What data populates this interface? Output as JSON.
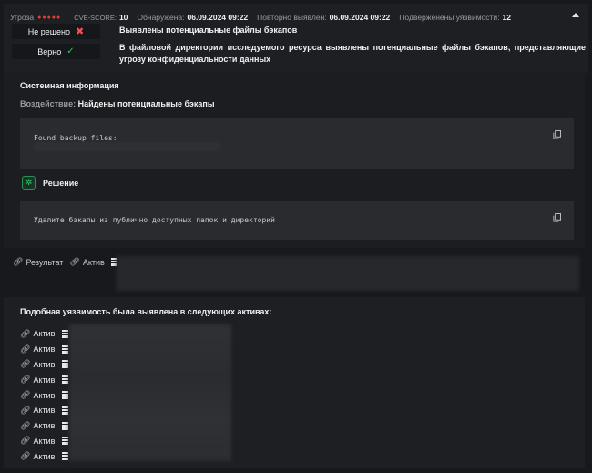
{
  "header": {
    "threat_label": "Угроза",
    "threat_dots": "●●●●●",
    "cve_label": "CVE-SCORE:",
    "cve_value": "10",
    "detected_label": "Обнаружена:",
    "detected_value": "06.09.2024 09:22",
    "redetected_label": "Повторно выявлен:",
    "redetected_value": "06.09.2024 09:22",
    "confirmed_label": "Подверженены уязвимости:",
    "confirmed_value": "12",
    "unresolved_label": "Не решено",
    "correct_label": "Верно",
    "title": "Выявлены потенциальные файлы бэкапов",
    "description": "В файловой директории исследуемого ресурса выявлены потенциальные файлы бэкапов, представляющие угрозу конфиденциальности данных"
  },
  "info": {
    "section_title": "Системная информация",
    "impact_label": "Воздействие:",
    "impact_value": "Найдены потенциальные бэкапы",
    "code_text": "Found backup files:",
    "solution_label": "Решение",
    "solution_text": "Удалите бэкапы из публично доступных папок и директорий"
  },
  "result": {
    "result_label": "Результат",
    "asset_label": "Актив"
  },
  "assets": {
    "title": "Подобная уязвимость была выявлена в следующих активах:",
    "items": [
      "Актив",
      "Актив",
      "Актив",
      "Актив",
      "Актив",
      "Актив",
      "Актив",
      "Актив",
      "Актив"
    ]
  },
  "colors": {
    "threat": "#e23c3c",
    "success": "#39c06b",
    "danger": "#ff4d4d"
  }
}
